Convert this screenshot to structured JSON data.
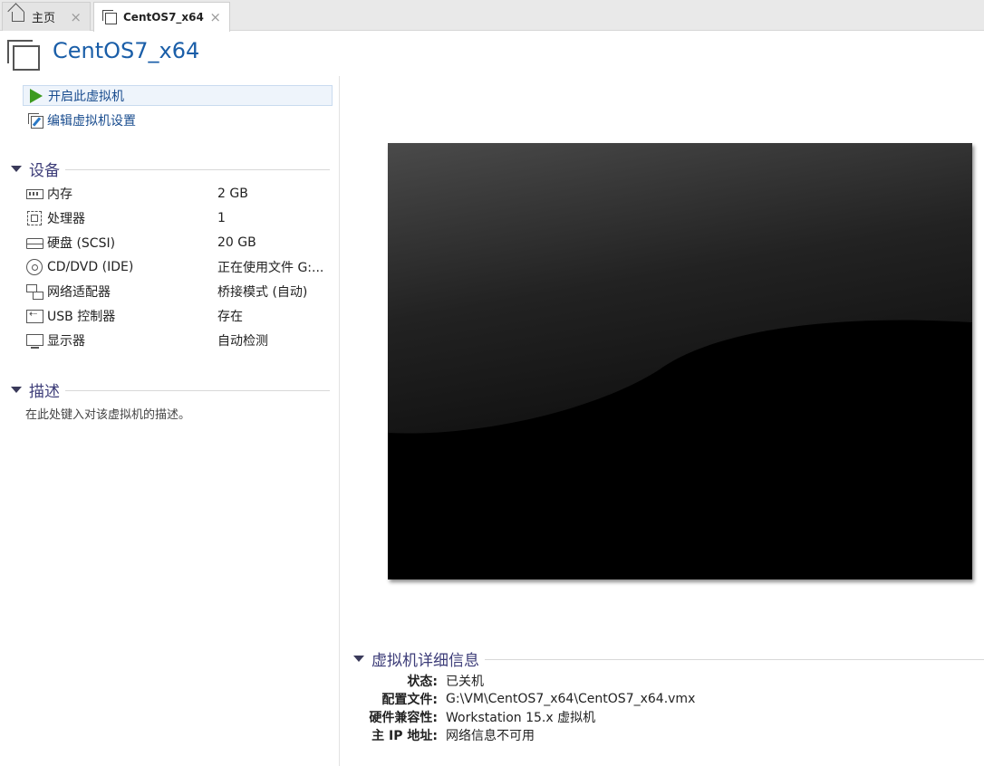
{
  "tabs": [
    {
      "label": "主页",
      "icon": "home-icon",
      "active": false
    },
    {
      "label": "CentOS7_x64",
      "icon": "vm-icon",
      "active": true
    }
  ],
  "tab_close_glyph": "×",
  "header": {
    "title": "CentOS7_x64"
  },
  "actions": {
    "power_on": "开启此虚拟机",
    "edit_settings": "编辑虚拟机设置"
  },
  "devices": {
    "heading": "设备",
    "items": [
      {
        "name": "内存",
        "value": "2 GB",
        "icon": "memory-icon"
      },
      {
        "name": "处理器",
        "value": "1",
        "icon": "processor-icon"
      },
      {
        "name": "硬盘 (SCSI)",
        "value": "20 GB",
        "icon": "hard-disk-icon"
      },
      {
        "name": "CD/DVD (IDE)",
        "value": "正在使用文件 G:...",
        "icon": "cd-dvd-icon"
      },
      {
        "name": "网络适配器",
        "value": "桥接模式 (自动)",
        "icon": "network-adapter-icon"
      },
      {
        "name": "USB 控制器",
        "value": "存在",
        "icon": "usb-controller-icon"
      },
      {
        "name": "显示器",
        "value": "自动检测",
        "icon": "display-icon"
      }
    ]
  },
  "description": {
    "heading": "描述",
    "placeholder": "在此处键入对该虚拟机的描述。"
  },
  "details": {
    "heading": "虚拟机详细信息",
    "rows": [
      {
        "key": "状态:",
        "value": "已关机"
      },
      {
        "key": "配置文件:",
        "value": "G:\\VM\\CentOS7_x64\\CentOS7_x64.vmx"
      },
      {
        "key": "硬件兼容性:",
        "value": "Workstation 15.x 虚拟机"
      },
      {
        "key": "主 IP 地址:",
        "value": "网络信息不可用"
      }
    ]
  },
  "colors": {
    "title": "#1a5ea8",
    "link": "#1a4d8f",
    "section_heading": "#3c3c78",
    "play": "#3c9a1e"
  }
}
